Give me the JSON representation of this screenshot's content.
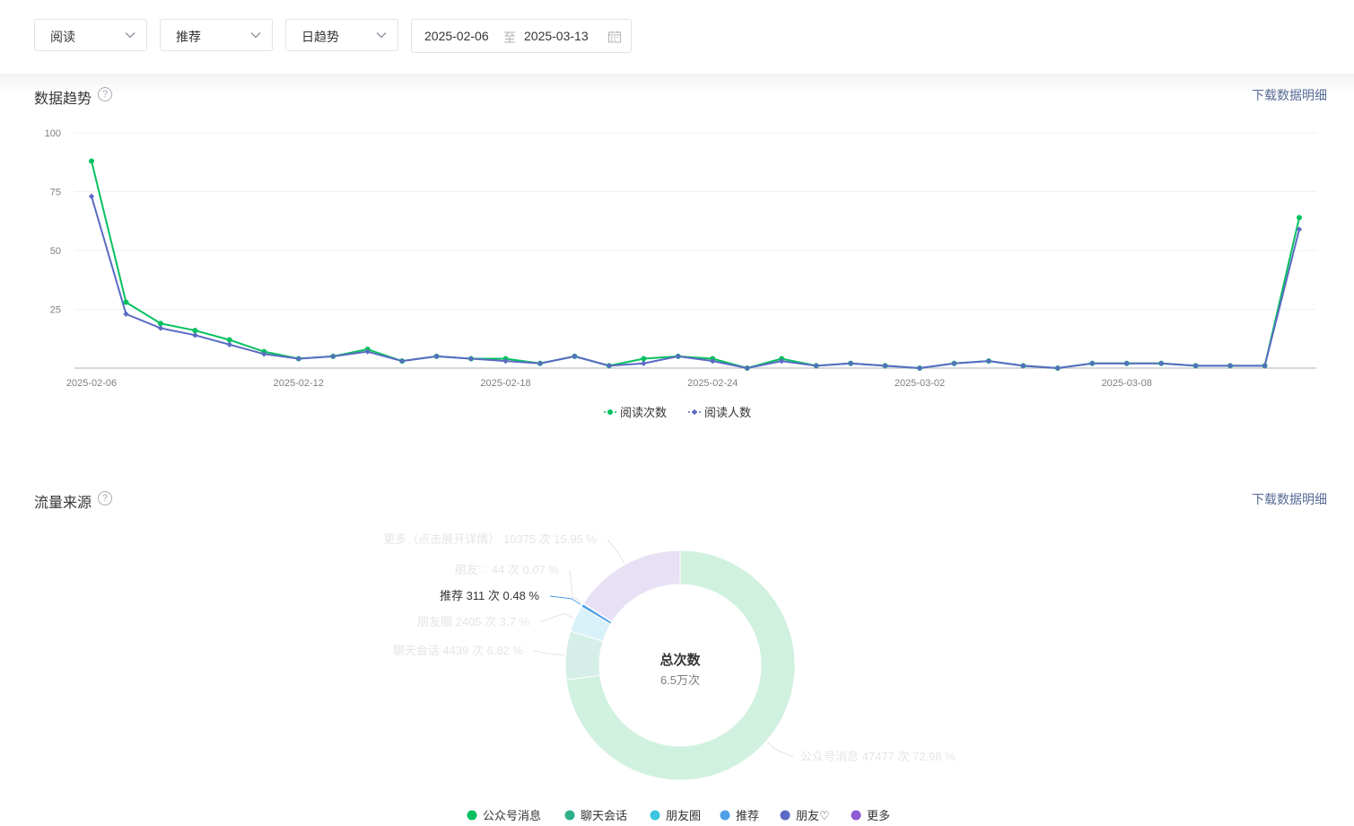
{
  "filters": {
    "metric": "阅读",
    "source": "推荐",
    "granularity": "日趋势",
    "date_start": "2025-02-06",
    "date_sep": "至",
    "date_end": "2025-03-13"
  },
  "trend": {
    "title": "数据趋势",
    "help": "?",
    "download": "下载数据明细"
  },
  "traffic": {
    "title": "流量来源",
    "help": "?",
    "download": "下载数据明细",
    "center_title": "总次数",
    "center_value": "6.5万次"
  },
  "colors": {
    "green": "#07c160",
    "blue": "#5b6bc4"
  },
  "chart_data": [
    {
      "type": "line",
      "x": [
        "2025-02-06",
        "2025-02-07",
        "2025-02-08",
        "2025-02-09",
        "2025-02-10",
        "2025-02-11",
        "2025-02-12",
        "2025-02-13",
        "2025-02-14",
        "2025-02-15",
        "2025-02-16",
        "2025-02-17",
        "2025-02-18",
        "2025-02-19",
        "2025-02-20",
        "2025-02-21",
        "2025-02-22",
        "2025-02-23",
        "2025-02-24",
        "2025-02-25",
        "2025-02-26",
        "2025-02-27",
        "2025-02-28",
        "2025-03-01",
        "2025-03-02",
        "2025-03-03",
        "2025-03-04",
        "2025-03-05",
        "2025-03-06",
        "2025-03-07",
        "2025-03-08",
        "2025-03-09",
        "2025-03-10",
        "2025-03-11",
        "2025-03-12",
        "2025-03-13"
      ],
      "x_tick_labels": [
        "2025-02-06",
        "2025-02-12",
        "2025-02-18",
        "2025-02-24",
        "2025-03-02",
        "2025-03-08"
      ],
      "y_ticks": [
        "25",
        "50",
        "75",
        "100"
      ],
      "ylim": [
        0,
        100
      ],
      "grid": true,
      "legend_position": "bottom",
      "series": [
        {
          "name": "阅读次数",
          "color": "#07c160",
          "marker": "circle",
          "values": [
            88,
            28,
            19,
            16,
            12,
            7,
            4,
            5,
            8,
            3,
            5,
            4,
            4,
            2,
            5,
            1,
            4,
            5,
            4,
            0,
            4,
            1,
            2,
            1,
            0,
            2,
            3,
            1,
            0,
            2,
            2,
            2,
            1,
            1,
            1,
            64
          ]
        },
        {
          "name": "阅读人数",
          "color": "#5b6bc4",
          "marker": "diamond",
          "values": [
            73,
            23,
            17,
            14,
            10,
            6,
            4,
            5,
            7,
            3,
            5,
            4,
            3,
            2,
            5,
            1,
            2,
            5,
            3,
            0,
            3,
            1,
            2,
            1,
            0,
            2,
            3,
            1,
            0,
            2,
            2,
            2,
            1,
            1,
            1,
            59
          ]
        }
      ]
    },
    {
      "type": "pie",
      "donut": true,
      "slices": [
        {
          "name": "公众号消息",
          "count": 47477,
          "percent": 72.98,
          "label": "公众号消息 47477 次 72.98 %",
          "color": "#d0f1df",
          "legend_color": "#07c160"
        },
        {
          "name": "聊天会话",
          "count": 4439,
          "percent": 6.82,
          "label": "聊天会话 4439 次 6.82 %",
          "color": "#d6eee8",
          "legend_color": "#2fb08b"
        },
        {
          "name": "朋友圈",
          "count": 2405,
          "percent": 3.7,
          "label": "朋友圈 2405 次 3.7 %",
          "color": "#d9f1f8",
          "legend_color": "#3bc5df"
        },
        {
          "name": "推荐",
          "count": 311,
          "percent": 0.48,
          "label": "推荐 311 次 0.48 %",
          "color": "#4d9fe8",
          "legend_color": "#4d9fe8",
          "highlight": true
        },
        {
          "name": "朋友♡",
          "count": 44,
          "percent": 0.07,
          "label": "朋友♡ 44 次 0.07 %",
          "color": "#dde1f3",
          "legend_color": "#5b6bc4"
        },
        {
          "name": "更多",
          "count": 10375,
          "percent": 15.95,
          "label": "更多（点击展开详情） 10375 次 15.95 %",
          "color": "#e8e0f4",
          "legend_color": "#8c5cd4"
        }
      ]
    }
  ]
}
